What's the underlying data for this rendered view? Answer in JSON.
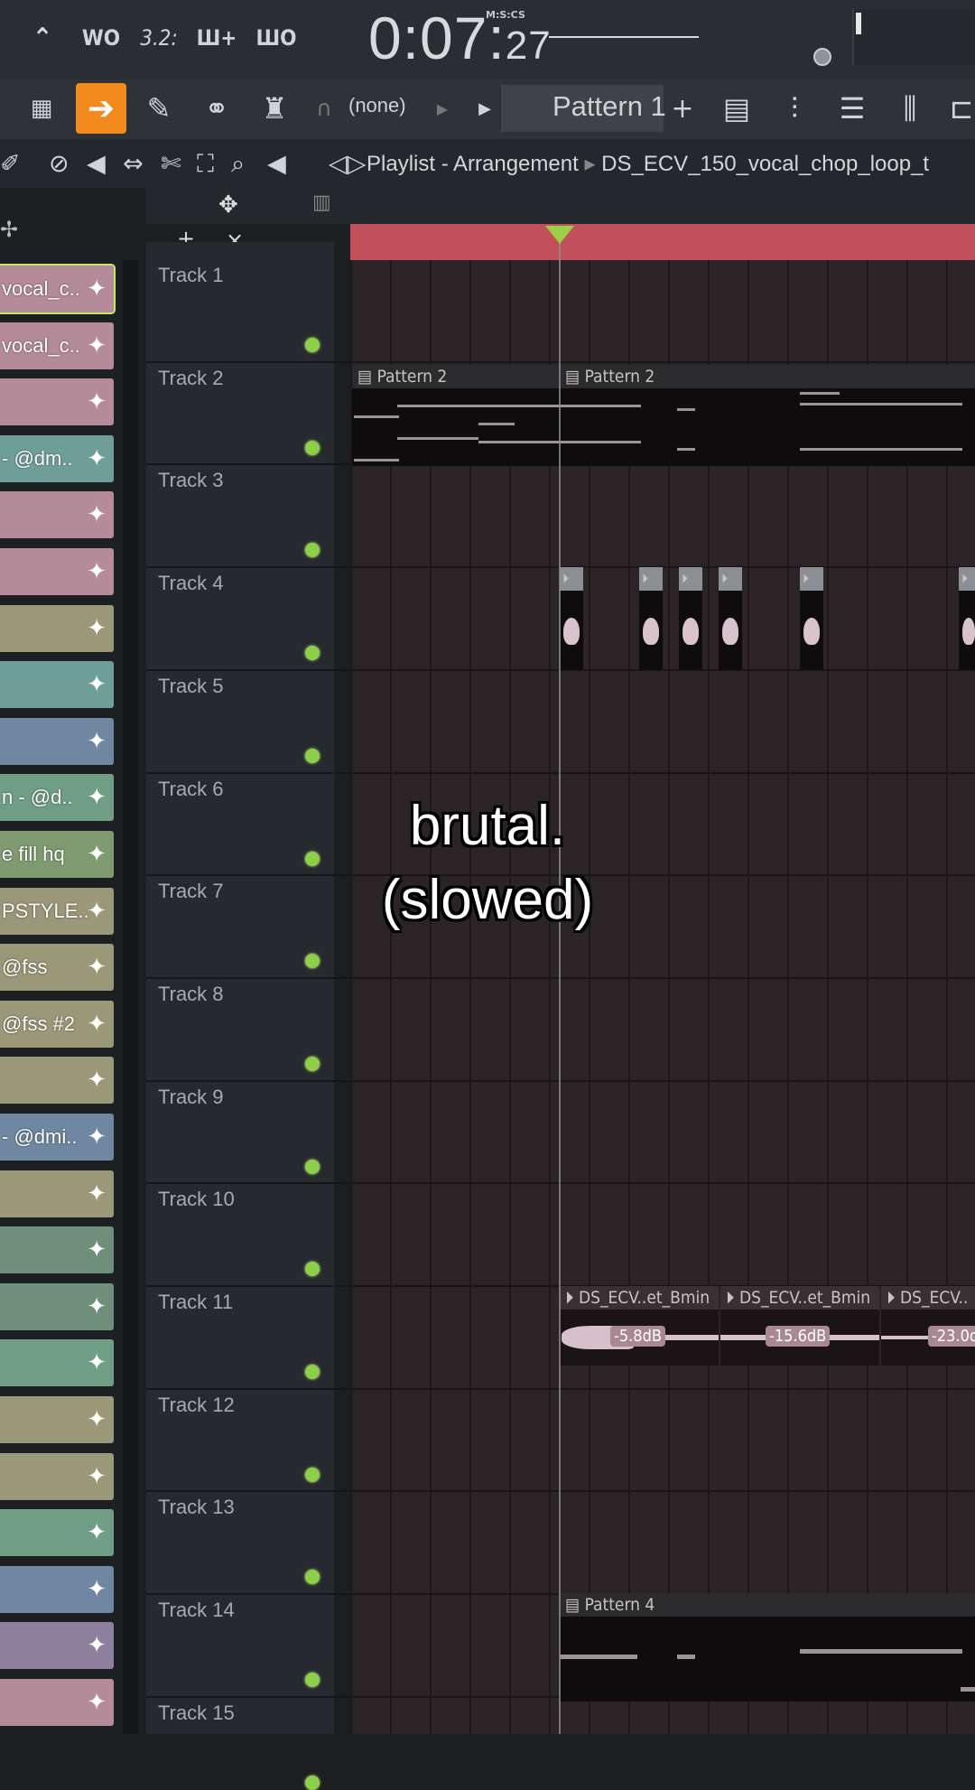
{
  "transport": {
    "time_main": "0:07:",
    "time_cs": "27",
    "time_format": "M:S:CS",
    "buttons": [
      "WO",
      "3.2:",
      "Ш+",
      "ШО"
    ]
  },
  "toolbar": {
    "snap_value": "(none)",
    "pattern_name": "Pattern 1",
    "add_label": "+"
  },
  "playlist": {
    "title": "Playlist - Arrangement",
    "separator": "▸",
    "file": "DS_ECV_150_vocal_chop_loop_t"
  },
  "picker": {
    "add_label": "+",
    "remove_label": "×",
    "items": [
      {
        "label": "vocal_c..",
        "color": "#b58a99",
        "selected": true
      },
      {
        "label": "vocal_c..",
        "color": "#b58a99"
      },
      {
        "label": "",
        "color": "#b58a99"
      },
      {
        "label": " - @dm..",
        "color": "#6f9e9a"
      },
      {
        "label": "",
        "color": "#b58a99"
      },
      {
        "label": "",
        "color": "#b58a99"
      },
      {
        "label": "",
        "color": "#9a9878"
      },
      {
        "label": "",
        "color": "#6f9e9a"
      },
      {
        "label": "",
        "color": "#6f87a0"
      },
      {
        "label": "n - @d..",
        "color": "#6f9e84"
      },
      {
        "label": "e fill hq",
        "color": "#7f9a70"
      },
      {
        "label": "PSTYLE..",
        "color": "#9a9878"
      },
      {
        "label": "@fss",
        "color": "#9a9878"
      },
      {
        "label": "@fss #2",
        "color": "#9a9878"
      },
      {
        "label": "",
        "color": "#9a9878"
      },
      {
        "label": " - @dmi..",
        "color": "#6f87a0"
      },
      {
        "label": "",
        "color": "#9a9878"
      },
      {
        "label": "",
        "color": "#6f8f7a"
      },
      {
        "label": "",
        "color": "#6f8f7a"
      },
      {
        "label": "",
        "color": "#6f9e84"
      },
      {
        "label": "",
        "color": "#9a9878"
      },
      {
        "label": "",
        "color": "#9a9878"
      },
      {
        "label": "",
        "color": "#6f9e84"
      },
      {
        "label": "",
        "color": "#6f87a0"
      },
      {
        "label": "",
        "color": "#8f7f9f"
      },
      {
        "label": "",
        "color": "#b58a99"
      }
    ]
  },
  "tracks": [
    "Track 1",
    "Track 2",
    "Track 3",
    "Track 4",
    "Track 5",
    "Track 6",
    "Track 7",
    "Track 8",
    "Track 9",
    "Track 10",
    "Track 11",
    "Track 12",
    "Track 13",
    "Track 14",
    "Track 15"
  ],
  "clips": {
    "pattern2_a": "Pattern 2",
    "pattern2_b": "Pattern 2",
    "pattern4": "Pattern 4",
    "audio1": "DS_ECV..et_Bmin",
    "audio2": "DS_ECV..et_Bmin",
    "audio3": "DS_ECV..",
    "vol1": "-5.8dB",
    "vol2": "-15.6dB",
    "vol3": "-23.0d"
  },
  "caption": {
    "line1": "brutal.",
    "line2": "(slowed)"
  },
  "colors": {
    "timeline": "#c2505a",
    "accent": "#f28a1e",
    "led": "#8ccf49"
  }
}
